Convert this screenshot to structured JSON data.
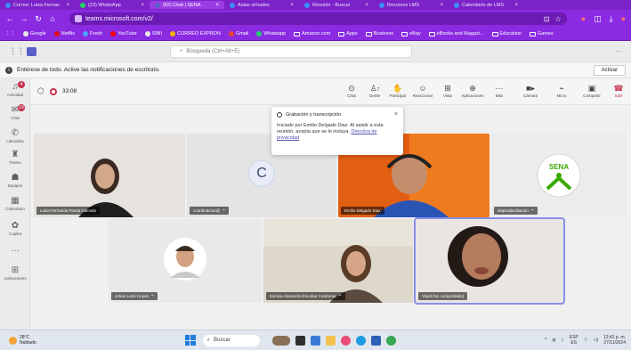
{
  "browser": {
    "tabs": [
      {
        "label": "Correo: Luisa Fernan",
        "active": false
      },
      {
        "label": "(23) WhatsApp",
        "active": false
      },
      {
        "label": "(62) Chat | SENA",
        "active": true
      },
      {
        "label": "Aulas virtuales",
        "active": false
      },
      {
        "label": "Reunión - Buscar",
        "active": false
      },
      {
        "label": "Recursos LMS",
        "active": false
      },
      {
        "label": "Calendario de LMS",
        "active": false
      }
    ],
    "url": "teams.microsoft.com/v2/",
    "bookmarks": [
      {
        "label": "Google",
        "kind": "site"
      },
      {
        "label": "Netflix",
        "kind": "site"
      },
      {
        "label": "Fresh",
        "kind": "site"
      },
      {
        "label": "YouTube",
        "kind": "site"
      },
      {
        "label": "SIMI",
        "kind": "site"
      },
      {
        "label": "CORREO EXPRON",
        "kind": "site"
      },
      {
        "label": "Gmail",
        "kind": "site"
      },
      {
        "label": "Whatsapp",
        "kind": "site"
      },
      {
        "label": "Amazon.com",
        "kind": "folder"
      },
      {
        "label": "Apps",
        "kind": "folder"
      },
      {
        "label": "Business",
        "kind": "folder"
      },
      {
        "label": "eBay",
        "kind": "folder"
      },
      {
        "label": "eBooks and Magazi...",
        "kind": "folder"
      },
      {
        "label": "Education",
        "kind": "folder"
      },
      {
        "label": "Games",
        "kind": "folder"
      }
    ]
  },
  "teams": {
    "search_placeholder": "Búsqueda (Ctrl+Alt+E)",
    "notice_text": "Entérese de todo. Active las notificaciones de escritorio.",
    "activate_label": "Activar",
    "rail": [
      {
        "label": "Actividad",
        "icon": "bell-icon",
        "badge": "4"
      },
      {
        "label": "Chat",
        "icon": "chat-icon",
        "badge": "19"
      },
      {
        "label": "Llamadas",
        "icon": "phone-icon",
        "badge": ""
      },
      {
        "label": "Teams",
        "icon": "teams-icon",
        "badge": ""
      },
      {
        "label": "Equipos",
        "icon": "people-icon",
        "badge": ""
      },
      {
        "label": "Calendario",
        "icon": "calendar-icon",
        "badge": ""
      },
      {
        "label": "Copilot",
        "icon": "copilot-icon",
        "badge": ""
      },
      {
        "label": "",
        "icon": "more-icon",
        "badge": ""
      },
      {
        "label": "Aplicaciones",
        "icon": "apps-icon",
        "badge": ""
      }
    ],
    "meeting": {
      "timer": "33:08",
      "tools": [
        {
          "label": "Chat",
          "icon": "chat-icon",
          "count": ""
        },
        {
          "label": "Gente",
          "icon": "people-icon",
          "count": "7"
        },
        {
          "label": "Participar",
          "icon": "hand-icon",
          "count": ""
        },
        {
          "label": "Reaccionar",
          "icon": "emoji-icon",
          "count": ""
        },
        {
          "label": "Vista",
          "icon": "grid-icon",
          "count": ""
        },
        {
          "label": "Aplicaciones",
          "icon": "apps-icon",
          "count": ""
        },
        {
          "label": "Más",
          "icon": "more-icon",
          "count": ""
        },
        {
          "label": "Cámara",
          "icon": "camera-icon",
          "count": ""
        },
        {
          "label": "Micro",
          "icon": "mic-icon",
          "count": ""
        },
        {
          "label": "Compartir",
          "icon": "share-icon",
          "count": ""
        },
        {
          "label": "Salir",
          "icon": "leave-icon",
          "count": ""
        }
      ]
    },
    "participants": [
      {
        "name": "Luisa Fernanda Posda Caicedo"
      },
      {
        "name": "coordinacion@"
      },
      {
        "name": "Emilio Delgado Diaz"
      },
      {
        "name": "elaprodacilitacion"
      },
      {
        "name": "Johan Lotro Hoyos"
      },
      {
        "name": "Monica Alexandra Escobar Contreras"
      },
      {
        "name": "Yeydi (No comprobado)"
      }
    ],
    "avatar_letter": "C",
    "sena_logo_text": "SENA",
    "popup": {
      "title": "Grabación y transcripción",
      "body": "Iniciado por Emilio Delgado Diaz. Al asistir a esta reunión, acepta que se le incluya.",
      "link": "Directiva de privacidad"
    }
  },
  "taskbar": {
    "weather_temp": "28°C",
    "weather_desc": "Nublado",
    "search_label": "Buscar",
    "lang": "ESP",
    "lang_sub": "ES",
    "time": "12:42 p. m.",
    "date": "27/11/2024"
  },
  "colors": {
    "browser_purple": "#8a2be2",
    "teams_accent": "#5b5fc7",
    "leave_red": "#c4314b",
    "sena_green": "#39a900"
  }
}
